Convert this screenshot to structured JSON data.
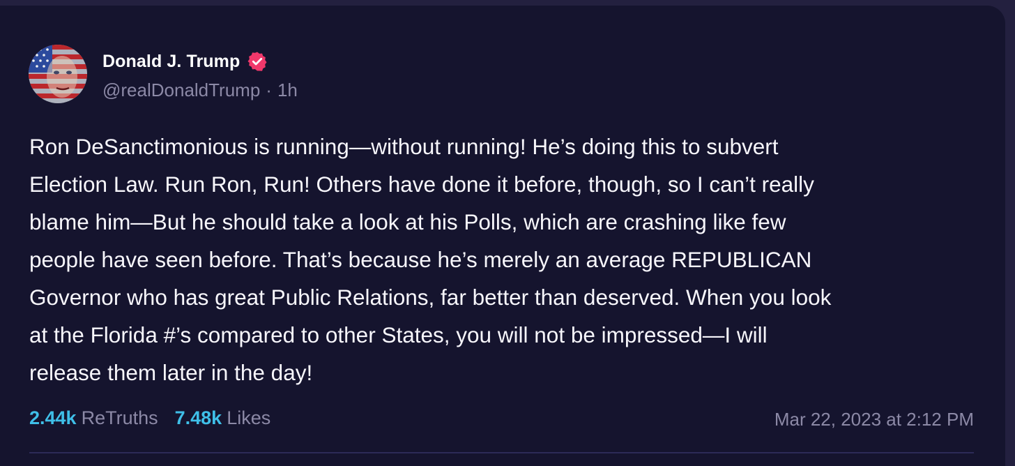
{
  "post": {
    "display_name": "Donald J. Trump",
    "verified_icon": "verified-badge-icon",
    "handle": "@realDonaldTrump",
    "separator": "·",
    "age": "1h",
    "body": "Ron DeSanctimonious is running—without running! He’s doing this to subvert\nElection Law. Run Ron, Run! Others have done it before, though, so I can’t really\nblame him—But he should take a look at his Polls, which are crashing like few\npeople have seen before. That’s because he’s merely an average REPUBLICAN\nGovernor who has great Public Relations, far better than deserved. When you look\nat the Florida #’s compared to other States, you will not be impressed—I will\nrelease them later in the day!",
    "stats": {
      "retruths_count": "2.44k",
      "retruths_label": "ReTruths",
      "likes_count": "7.48k",
      "likes_label": "Likes"
    },
    "timestamp": "Mar 22, 2023 at 2:12 PM"
  },
  "colors": {
    "page_background": "#23203f",
    "card_background": "#15142e",
    "accent_count": "#3fbfe8",
    "muted_text": "#8c89a6",
    "verified_badge": "#f0386b"
  }
}
